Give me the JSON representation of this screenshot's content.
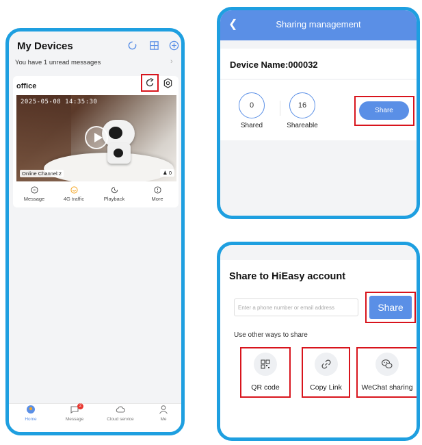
{
  "phone1": {
    "title": "My Devices",
    "unread": "You have 1 unread messages",
    "device": {
      "name": "office",
      "timestamp": "2025-05-08 14:35:30",
      "online_channel": "Online Channel:2",
      "viewer_count": "0"
    },
    "actions": [
      "Message",
      "4G traffic",
      "Playback",
      "More"
    ],
    "tabs": [
      {
        "label": "Home",
        "active": true
      },
      {
        "label": "Message",
        "badge": "2"
      },
      {
        "label": "Cloud service"
      },
      {
        "label": "Me"
      }
    ]
  },
  "phone2": {
    "title": "Sharing management",
    "device_name": "Device Name:000032",
    "shared": {
      "value": "0",
      "label": "Shared"
    },
    "shareable": {
      "value": "16",
      "label": "Shareable"
    },
    "share_button": "Share"
  },
  "phone3": {
    "title": "Share to HiEasy account",
    "input_placeholder": "Enter a phone number or email address",
    "share_button": "Share",
    "other_label": "Use other ways to share",
    "options": [
      "QR code",
      "Copy Link",
      "WeChat sharing"
    ]
  },
  "colors": {
    "frame": "#1e9fe0",
    "accent": "#5a8fe6",
    "highlight": "#d8141c",
    "active_orange": "#f5a623"
  }
}
